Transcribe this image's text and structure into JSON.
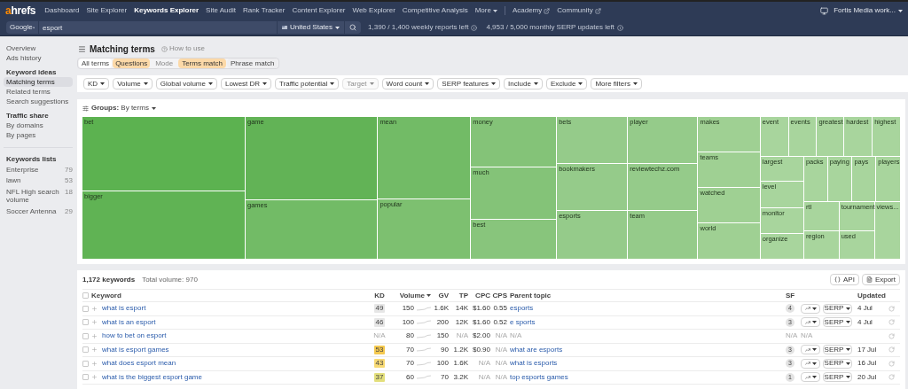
{
  "nav": {
    "logo": {
      "accent": "a",
      "rest": "hrefs"
    },
    "items": [
      {
        "label": "Dashboard",
        "selected": false,
        "kind": "link"
      },
      {
        "label": "Site Explorer",
        "selected": false,
        "kind": "link"
      },
      {
        "label": "Keywords Explorer",
        "selected": true,
        "kind": "link"
      },
      {
        "label": "Site Audit",
        "selected": false,
        "kind": "link"
      },
      {
        "label": "Rank Tracker",
        "selected": false,
        "kind": "link"
      },
      {
        "label": "Content Explorer",
        "selected": false,
        "kind": "link"
      },
      {
        "label": "Web Explorer",
        "selected": false,
        "kind": "link"
      },
      {
        "label": "Competitive Analysis",
        "selected": false,
        "kind": "link"
      },
      {
        "label": "More",
        "selected": false,
        "kind": "menu"
      }
    ],
    "external_links": [
      "Academy",
      "Community"
    ],
    "account": "Fortis Media work..."
  },
  "search": {
    "engine": "Google",
    "query": "esport",
    "country": "United States",
    "quota": [
      "1,390 / 1,400 weekly reports left",
      "4,953 / 5,000 monthly SERP updates left"
    ]
  },
  "sidebar": {
    "sections": [
      {
        "items": [
          {
            "label": "Overview",
            "selected": false
          },
          {
            "label": "Ads history",
            "selected": false
          }
        ]
      },
      {
        "title": "Keyword ideas",
        "items": [
          {
            "label": "Matching terms",
            "selected": true
          },
          {
            "label": "Related terms",
            "selected": false
          },
          {
            "label": "Search suggestions",
            "selected": false
          }
        ]
      },
      {
        "title": "Traffic share",
        "items": [
          {
            "label": "By domains",
            "selected": false
          },
          {
            "label": "By pages",
            "selected": false
          }
        ]
      }
    ],
    "lists": {
      "title": "Keywords lists",
      "items": [
        {
          "label": "Enterprise",
          "count": "79"
        },
        {
          "label": "lawn",
          "count": "53"
        },
        {
          "label": "NFL High search volume",
          "count": "18"
        },
        {
          "label": "Soccer Antenna",
          "count": "29"
        }
      ]
    }
  },
  "page": {
    "title": "Matching terms",
    "help": "How to use",
    "tabs": [
      {
        "label": "All terms",
        "selected": false
      },
      {
        "label": "Questions",
        "selected": true
      }
    ],
    "mode_label": "Mode",
    "modes": [
      {
        "label": "Terms match",
        "selected": true
      },
      {
        "label": "Phrase match",
        "selected": false
      }
    ],
    "filters": [
      {
        "label": "KD",
        "disabled": false
      },
      {
        "label": "Volume",
        "disabled": false
      },
      {
        "label": "Global volume",
        "disabled": false
      },
      {
        "label": "Lowest DR",
        "disabled": false
      },
      {
        "label": "Traffic potential",
        "disabled": false
      },
      {
        "label": "Target",
        "disabled": true
      },
      {
        "label": "Word count",
        "disabled": false
      },
      {
        "label": "SERP features",
        "disabled": false
      },
      {
        "label": "Include",
        "disabled": false
      },
      {
        "label": "Exclude",
        "disabled": false
      },
      {
        "label": "More filters",
        "disabled": false
      }
    ],
    "treemap": {
      "groups": "**Groups:** By terms",
      "tiles": [
        {
          "label": "bet",
          "color": "#5cb250"
        },
        {
          "label": "bigger",
          "color": "#60b354"
        },
        {
          "label": "game",
          "color": "#62b356"
        },
        {
          "label": "games",
          "color": "#72bb66"
        },
        {
          "label": "mean",
          "color": "#72bb66"
        },
        {
          "label": "popular",
          "color": "#7dc070"
        },
        {
          "label": "money",
          "color": "#84c378"
        },
        {
          "label": "much",
          "color": "#84c378"
        },
        {
          "label": "best",
          "color": "#88c57c"
        },
        {
          "label": "bets",
          "color": "#95cb8a"
        },
        {
          "label": "bookmakers",
          "color": "#95cb8a"
        },
        {
          "label": "esports",
          "color": "#95cb8a"
        },
        {
          "label": "player",
          "color": "#95cb8a"
        },
        {
          "label": "reviewtechz.com",
          "color": "#95cb8a"
        },
        {
          "label": "team",
          "color": "#95cb8a"
        },
        {
          "label": "makes",
          "color": "#9fd093"
        },
        {
          "label": "teams",
          "color": "#9fd093"
        },
        {
          "label": "watched",
          "color": "#9fd093"
        },
        {
          "label": "world",
          "color": "#9fd093"
        },
        {
          "label": "event",
          "color": "#a8d59d"
        },
        {
          "label": "events",
          "color": "#a8d59d"
        },
        {
          "label": "greatest",
          "color": "#a8d59d"
        },
        {
          "label": "hardest",
          "color": "#a8d59d"
        },
        {
          "label": "highest",
          "color": "#a8d59d"
        },
        {
          "label": "largest",
          "color": "#a8d59d"
        },
        {
          "label": "level",
          "color": "#a8d59d"
        },
        {
          "label": "monitor",
          "color": "#a8d59d"
        },
        {
          "label": "organize",
          "color": "#a8d59d"
        },
        {
          "label": "packs",
          "color": "#a8d59d"
        },
        {
          "label": "paying",
          "color": "#a8d59d"
        },
        {
          "label": "pays",
          "color": "#a8d59d"
        },
        {
          "label": "players",
          "color": "#a8d59d"
        },
        {
          "label": "rtl",
          "color": "#a8d59d"
        },
        {
          "label": "region",
          "color": "#a8d59d"
        },
        {
          "label": "tournament",
          "color": "#a8d59d"
        },
        {
          "label": "used",
          "color": "#a8d59d"
        },
        {
          "label": "views...",
          "color": "#a8d59d"
        }
      ]
    },
    "table": {
      "count": "1,172 keywords",
      "total": "Total volume: 970",
      "all_checked": false,
      "actions": [
        {
          "label": "API",
          "kind": "api"
        },
        {
          "label": "Export",
          "kind": "export"
        }
      ],
      "columns": [
        {
          "label": "Keyword",
          "sorted": false
        },
        {
          "label": "KD",
          "sorted": false
        },
        {
          "label": "Volume",
          "sorted": true
        },
        {
          "label": "GV",
          "sorted": false
        },
        {
          "label": "TP",
          "sorted": false
        },
        {
          "label": "CPC",
          "sorted": false
        },
        {
          "label": "CPS",
          "sorted": false
        },
        {
          "label": "Parent topic",
          "sorted": false
        },
        {
          "label": "SF",
          "sorted": false
        },
        {
          "label": "Updated",
          "sorted": false
        }
      ],
      "rows": [
        {
          "checked": false,
          "keyword": "what is esport",
          "kd": {
            "text": "49",
            "muted": false,
            "color": "#e6e6e6"
          },
          "volume": "150",
          "gv": "1.6K",
          "tp": {
            "text": "14K",
            "muted": false
          },
          "cpc": {
            "text": "$1.60",
            "muted": false
          },
          "cps": {
            "text": "0.55",
            "muted": false
          },
          "parent": {
            "text": "esports",
            "muted": false
          },
          "sf": {
            "text": "4",
            "muted": false
          },
          "serp": true,
          "serp_label": "SERP",
          "updated": "4 Jul"
        },
        {
          "checked": false,
          "keyword": "what is an esport",
          "kd": {
            "text": "46",
            "muted": false,
            "color": "#e6e6e6"
          },
          "volume": "100",
          "gv": "200",
          "tp": {
            "text": "12K",
            "muted": false
          },
          "cpc": {
            "text": "$1.60",
            "muted": false
          },
          "cps": {
            "text": "0.52",
            "muted": false
          },
          "parent": {
            "text": "e sports",
            "muted": false
          },
          "sf": {
            "text": "3",
            "muted": false
          },
          "serp": true,
          "serp_label": "SERP",
          "updated": "4 Jul"
        },
        {
          "checked": false,
          "keyword": "how to bet on esport",
          "kd": {
            "text": "N/A",
            "muted": true
          },
          "volume": "80",
          "gv": "150",
          "tp": {
            "text": "N/A",
            "muted": true
          },
          "cpc": {
            "text": "$2.00",
            "muted": false
          },
          "cps": {
            "text": "N/A",
            "muted": true
          },
          "parent": {
            "text": "N/A",
            "muted": true
          },
          "sf": {
            "text": "N/A",
            "muted": true
          },
          "serp": false,
          "serp_note": "N/A"
        },
        {
          "checked": false,
          "keyword": "what is esport games",
          "kd": {
            "text": "53",
            "muted": false,
            "color": "#f5c94f"
          },
          "volume": "70",
          "gv": "90",
          "tp": {
            "text": "1.2K",
            "muted": false
          },
          "cpc": {
            "text": "$0.90",
            "muted": false
          },
          "cps": {
            "text": "N/A",
            "muted": true
          },
          "parent": {
            "text": "what are esports",
            "muted": false
          },
          "sf": {
            "text": "3",
            "muted": false
          },
          "serp": true,
          "serp_label": "SERP",
          "updated": "17 Jul"
        },
        {
          "checked": false,
          "keyword": "what does esport mean",
          "kd": {
            "text": "43",
            "muted": false,
            "color": "#f8da74"
          },
          "volume": "70",
          "gv": "100",
          "tp": {
            "text": "1.6K",
            "muted": false
          },
          "cpc": {
            "text": "N/A",
            "muted": true
          },
          "cps": {
            "text": "N/A",
            "muted": true
          },
          "parent": {
            "text": "what is esports",
            "muted": false
          },
          "sf": {
            "text": "3",
            "muted": false
          },
          "serp": true,
          "serp_label": "SERP",
          "updated": "16 Jul"
        },
        {
          "checked": false,
          "keyword": "what is the biggest esport game",
          "kd": {
            "text": "37",
            "muted": false,
            "color": "#e3df7c"
          },
          "volume": "60",
          "gv": "70",
          "tp": {
            "text": "3.2K",
            "muted": false
          },
          "cpc": {
            "text": "N/A",
            "muted": true
          },
          "cps": {
            "text": "N/A",
            "muted": true
          },
          "parent": {
            "text": "top esports games",
            "muted": false
          },
          "sf": {
            "text": "1",
            "muted": false
          },
          "serp": true,
          "serp_label": "SERP",
          "updated": "20 Jul"
        }
      ]
    }
  }
}
